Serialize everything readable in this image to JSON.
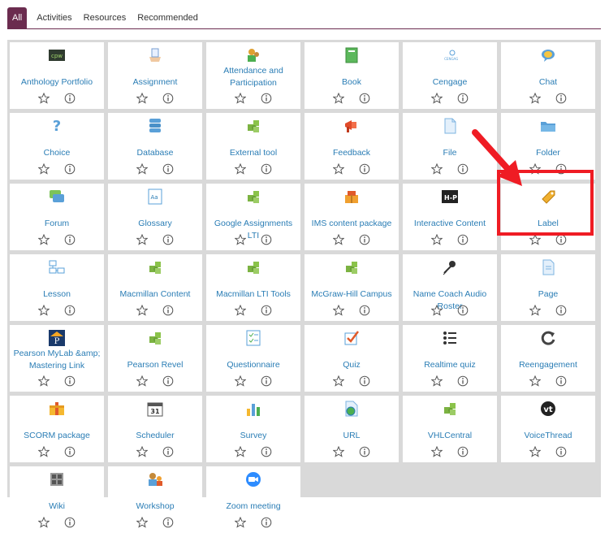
{
  "tabs": [
    "All",
    "Activities",
    "Resources",
    "Recommended"
  ],
  "active_tab": "All",
  "items": [
    {
      "label": "Anthology Portfolio",
      "icon": "anthology-portfolio-icon"
    },
    {
      "label": "Assignment",
      "icon": "assignment-icon"
    },
    {
      "label": "Attendance and Participation",
      "icon": "attendance-icon"
    },
    {
      "label": "Book",
      "icon": "book-icon"
    },
    {
      "label": "Cengage",
      "icon": "cengage-icon"
    },
    {
      "label": "Chat",
      "icon": "chat-icon"
    },
    {
      "label": "Choice",
      "icon": "choice-icon"
    },
    {
      "label": "Database",
      "icon": "database-icon"
    },
    {
      "label": "External tool",
      "icon": "puzzle-icon"
    },
    {
      "label": "Feedback",
      "icon": "feedback-icon"
    },
    {
      "label": "File",
      "icon": "file-icon"
    },
    {
      "label": "Folder",
      "icon": "folder-icon"
    },
    {
      "label": "Forum",
      "icon": "forum-icon"
    },
    {
      "label": "Glossary",
      "icon": "glossary-icon"
    },
    {
      "label": "Google Assignments LTI",
      "icon": "puzzle-icon"
    },
    {
      "label": "IMS content package",
      "icon": "ims-package-icon"
    },
    {
      "label": "Interactive Content",
      "icon": "h5p-icon"
    },
    {
      "label": "Label",
      "icon": "label-tag-icon"
    },
    {
      "label": "Lesson",
      "icon": "lesson-icon"
    },
    {
      "label": "Macmillan Content",
      "icon": "puzzle-icon"
    },
    {
      "label": "Macmillan LTI Tools",
      "icon": "puzzle-icon"
    },
    {
      "label": "McGraw-Hill Campus",
      "icon": "puzzle-icon"
    },
    {
      "label": "Name Coach Audio Roster",
      "icon": "microphone-icon"
    },
    {
      "label": "Page",
      "icon": "page-icon"
    },
    {
      "label": "Pearson MyLab &amp; Mastering Link",
      "icon": "pearson-icon"
    },
    {
      "label": "Pearson Revel",
      "icon": "puzzle-icon"
    },
    {
      "label": "Questionnaire",
      "icon": "questionnaire-icon"
    },
    {
      "label": "Quiz",
      "icon": "quiz-icon"
    },
    {
      "label": "Realtime quiz",
      "icon": "realtime-quiz-icon"
    },
    {
      "label": "Reengagement",
      "icon": "reengagement-icon"
    },
    {
      "label": "SCORM package",
      "icon": "scorm-icon"
    },
    {
      "label": "Scheduler",
      "icon": "calendar-icon"
    },
    {
      "label": "Survey",
      "icon": "survey-chart-icon"
    },
    {
      "label": "URL",
      "icon": "url-globe-icon"
    },
    {
      "label": "VHLCentral",
      "icon": "puzzle-icon"
    },
    {
      "label": "VoiceThread",
      "icon": "voicethread-icon"
    },
    {
      "label": "Wiki",
      "icon": "wiki-icon"
    },
    {
      "label": "Workshop",
      "icon": "workshop-icon"
    },
    {
      "label": "Zoom meeting",
      "icon": "zoom-icon"
    }
  ],
  "icon_text": {
    "cengage": "CENGAGE",
    "h5p": "H-P",
    "calendar": "31",
    "pearson": "P",
    "voicethread": "vt"
  },
  "colors": {
    "accent": "#6b2c4f",
    "link": "#2a7db5",
    "highlight": "#ef1c24",
    "tile_bg": "#ffffff",
    "grid_bg": "#d9d9d9"
  }
}
